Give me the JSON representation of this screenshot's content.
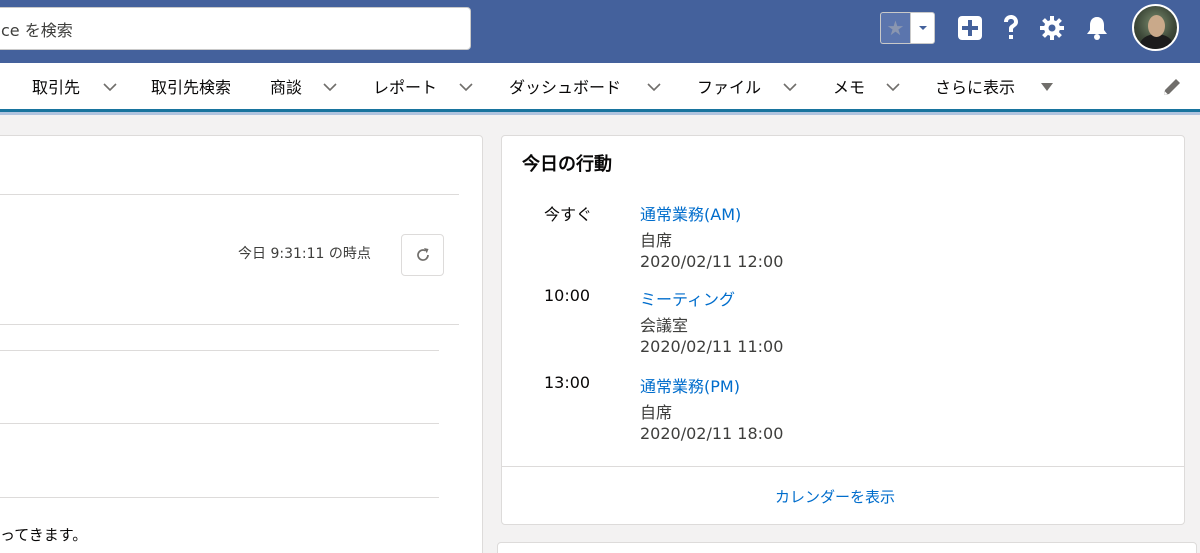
{
  "header": {
    "search_text": "ce を検索",
    "icons": [
      "star-icon",
      "caret-down-icon",
      "plus-icon",
      "help-icon",
      "gear-icon",
      "bell-icon"
    ]
  },
  "nav": {
    "items": [
      {
        "label": "取引先",
        "has_chevron": true
      },
      {
        "label": "取引先検索",
        "has_chevron": false
      },
      {
        "label": "商談",
        "has_chevron": true
      },
      {
        "label": "レポート",
        "has_chevron": true
      },
      {
        "label": "ダッシュボード",
        "has_chevron": true
      },
      {
        "label": "ファイル",
        "has_chevron": true
      },
      {
        "label": "メモ",
        "has_chevron": true
      },
      {
        "label": "さらに表示",
        "has_chevron": false
      }
    ]
  },
  "left_panel": {
    "as_of": "今日 9:31:11 の時点",
    "footer_text": "ってきます。"
  },
  "today_panel": {
    "title": "今日の行動",
    "events": [
      {
        "time": "今すぐ",
        "subject": "通常業務(AM)",
        "location": "自席",
        "datetime": "2020/02/11 12:00"
      },
      {
        "time": "10:00",
        "subject": "ミーティング",
        "location": "会議室",
        "datetime": "2020/02/11 11:00"
      },
      {
        "time": "13:00",
        "subject": "通常業務(PM)",
        "location": "自席",
        "datetime": "2020/02/11 18:00"
      }
    ],
    "calendar_link": "カレンダーを表示"
  },
  "colors": {
    "header_bg": "#44619c",
    "nav_accent": "#18749e",
    "link": "#006dcc"
  }
}
